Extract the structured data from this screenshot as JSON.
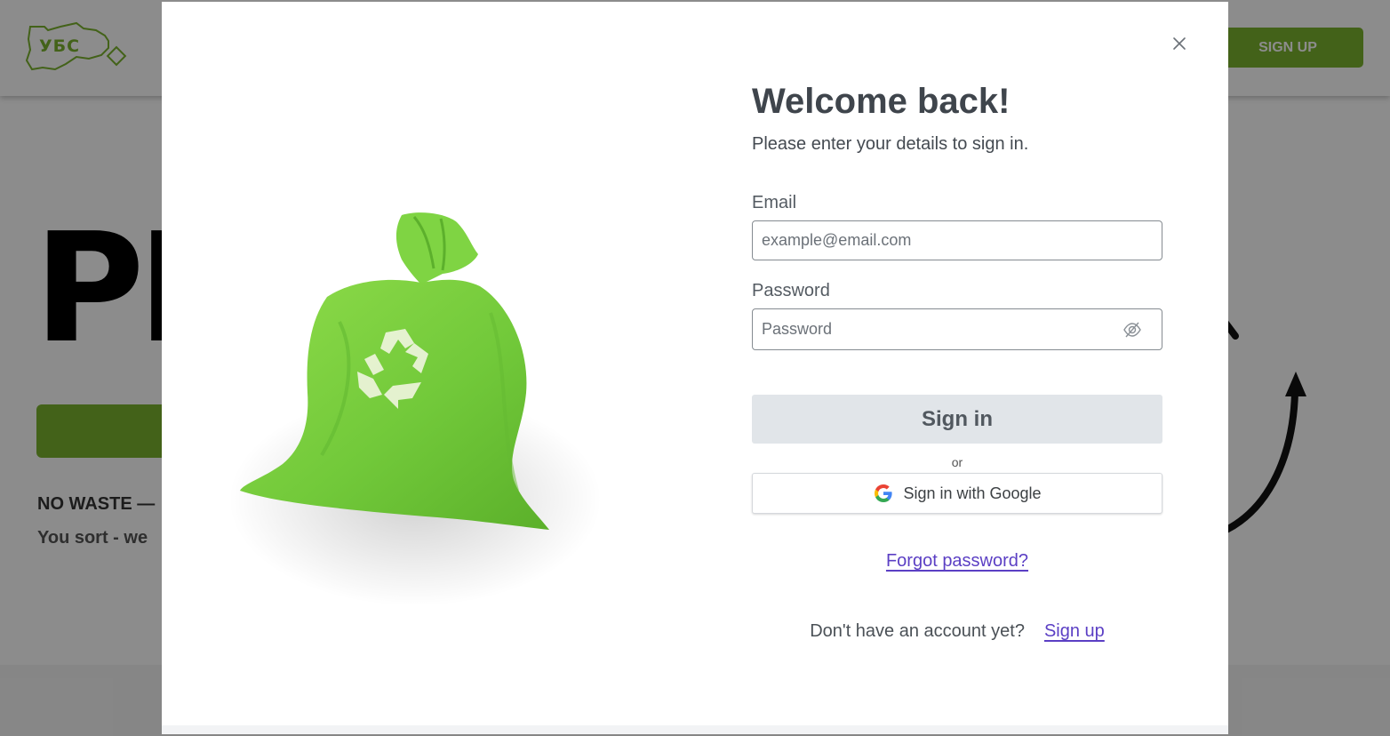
{
  "header": {
    "logo_text": "УБС",
    "signup_label": "SIGN UP"
  },
  "hero": {
    "title_fragment": "PI",
    "subtitle_line1": "NO WASTE —",
    "subtitle_line2": "You sort - we"
  },
  "modal": {
    "title": "Welcome back!",
    "subtitle": "Please enter your details to sign in.",
    "email_label": "Email",
    "email_placeholder": "example@email.com",
    "password_label": "Password",
    "password_placeholder": "Password",
    "signin_label": "Sign in",
    "or_text": "or",
    "google_label": "Sign in with Google",
    "forgot_label": "Forgot password?",
    "no_account_text": "Don't have an account yet?",
    "signup_link": "Sign up"
  },
  "icons": {
    "close": "close-icon",
    "eye": "eye-off-icon",
    "google": "google-logo-icon",
    "recycle": "recycle-icon"
  },
  "colors": {
    "brand_green": "#7ab32e",
    "link_purple": "#5b3fc4",
    "signin_disabled_bg": "#e1e5e9"
  }
}
